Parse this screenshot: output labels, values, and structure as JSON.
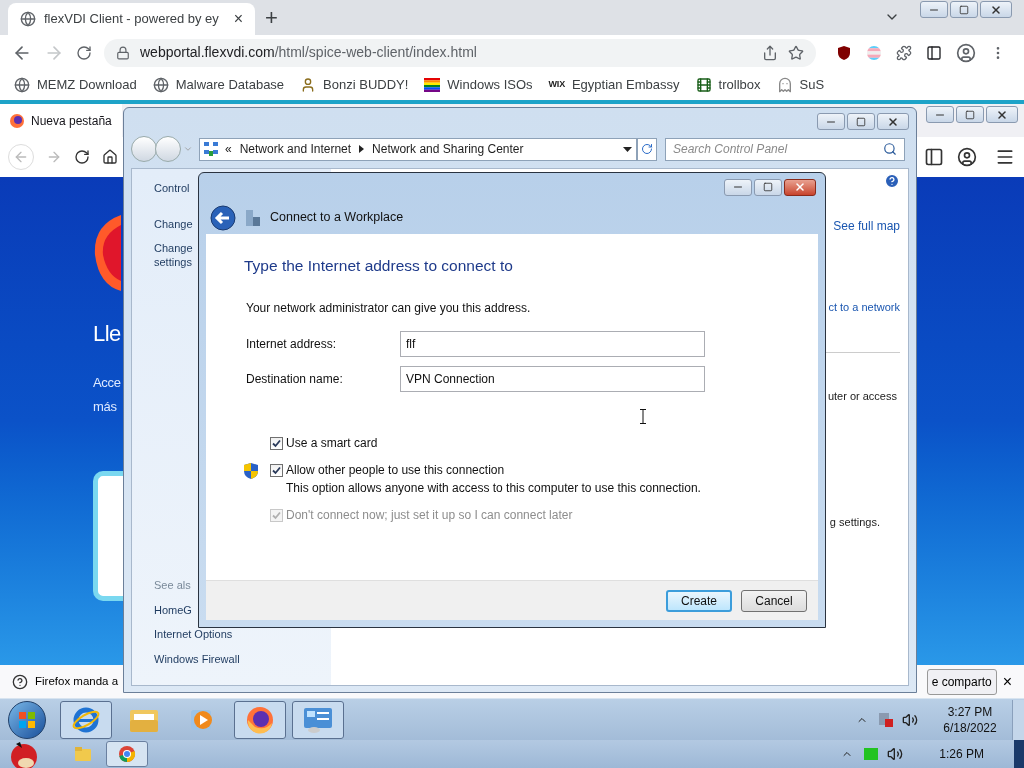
{
  "browser": {
    "tab": {
      "title": "flexVDI Client - powered by ey",
      "close": "×"
    },
    "new_tab": "+",
    "url": {
      "domain": "webportal.flexvdi.com",
      "path": "/html/spice-web-client/index.html"
    },
    "bookmarks": [
      {
        "kind": "globe",
        "label": "MEMZ Download"
      },
      {
        "kind": "globe",
        "label": "Malware Database"
      },
      {
        "kind": "figure",
        "label": "Bonzi BUDDY!"
      },
      {
        "kind": "flag",
        "label": "Windows ISOs"
      },
      {
        "kind": "text",
        "icon_text": "WIX",
        "label": "Egyptian Embassy"
      },
      {
        "kind": "film",
        "label": "trollbox"
      },
      {
        "kind": "ghost",
        "label": "SuS"
      }
    ]
  },
  "firefox": {
    "tab": "Nueva pestaña",
    "heading": "Lle",
    "lines": [
      "Acce",
      "más"
    ],
    "notification": {
      "text": "Firefox manda a",
      "button": "e comparto",
      "close": "×"
    }
  },
  "control_panel": {
    "breadcrumb_prefix": "«",
    "breadcrumb": [
      "Network and Internet",
      "Network and Sharing Center"
    ],
    "search_placeholder": "Search Control Panel",
    "left_links": [
      "Control",
      "Change",
      "Change settings"
    ],
    "see_also": "See als",
    "see_also_links": [
      "HomeG",
      "Internet Options",
      "Windows Firewall"
    ],
    "right_texts": [
      "See full map",
      "ct to a network",
      "uter or access",
      "g settings."
    ]
  },
  "dialog": {
    "title": "Connect to a Workplace",
    "heading": "Type the Internet address to connect to",
    "intro": "Your network administrator can give you this address.",
    "fields": [
      {
        "label": "Internet address:",
        "value": "flf"
      },
      {
        "label": "Destination name:",
        "value": "VPN Connection"
      }
    ],
    "options": [
      {
        "label": "Use a smart card",
        "checked": true,
        "disabled": false,
        "shield": false
      },
      {
        "label": "Allow other people to use this connection",
        "note": "This option allows anyone with access to this computer to use this connection.",
        "checked": true,
        "disabled": false,
        "shield": true
      },
      {
        "label": "Don't connect now; just set it up so I can connect later",
        "checked": true,
        "disabled": true,
        "shield": false
      }
    ],
    "buttons": [
      {
        "label": "Create",
        "default": true
      },
      {
        "label": "Cancel",
        "default": false
      }
    ]
  },
  "remote_taskbar": {
    "items": [
      {
        "kind": "ie",
        "open": true
      },
      {
        "kind": "explorer",
        "open": false
      },
      {
        "kind": "media",
        "open": false
      },
      {
        "kind": "firefox",
        "open": true
      },
      {
        "kind": "control_panel",
        "open": true
      }
    ],
    "time": "3:27 PM",
    "date": "6/18/2022"
  },
  "host_taskbar": {
    "items": [
      {
        "kind": "folder",
        "open": false
      },
      {
        "kind": "chrome",
        "open": true
      }
    ],
    "time": "1:26 PM"
  }
}
